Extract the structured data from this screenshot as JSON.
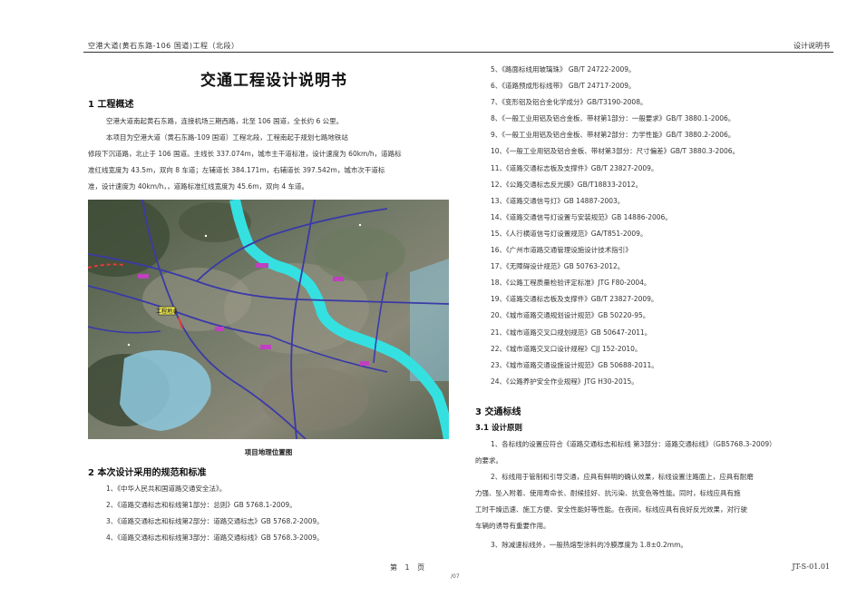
{
  "header": {
    "left": "空港大道(黄石东路-106 国道)工程（北段）",
    "right": "设计说明书"
  },
  "title": "交通工程设计说明书",
  "section1": {
    "heading": "1  工程概述",
    "paragraphs": [
      "空港大道南起黄石东路，连接机场三期西路，北至 106 国道，全长约 6 公里。",
      "本项目为空港大道（黄石东路-109 国道）工程北段，工程南起于规划七路地铁站",
      "修段下沉道路，北止于 106 国道。主线长 337.074m，城市主干道标准，设计速度为 60km/h，道路标",
      "准红线宽度为 43.5m，双向 8 车道；左辅道长 384.171m，右辅道长 397.542m，城市次干道标",
      "准，设计速度为 40km/h，，道路标准红线宽度为 45.6m，双向 4 车道。"
    ]
  },
  "map": {
    "caption": "项目地理位置图",
    "label": "工程地点"
  },
  "section2": {
    "heading": "2  本次设计采用的规范和标准",
    "items": [
      "1、《中华人民共和国道路交通安全法》。",
      "2、《道路交通标志和标线第1部分：总则》GB  5768.1-2009。",
      "3、《道路交通标志和标线第2部分：道路交通标志》GB  5768.2-2009。",
      "4、《道路交通标志和标线第3部分：道路交通标线》GB  5768.3-2009。"
    ]
  },
  "right_list": {
    "items": [
      "5、《路面标线用玻璃珠》  GB/T  24722-2009。",
      "6、《道路预成形标线带》  GB/T  24717-2009。",
      "7、《变形铝及铝合金化学成分》GB/T3190-2008。",
      "8、《一般工业用铝及铝合金板、带材第1部分：一般要求》GB/T  3880.1-2006。",
      "9、《一般工业用铝及铝合金板、带材第2部分：力学性能》GB/T  3880.2-2006。",
      "10、《一般工业用铝及铝合金板、带材第3部分：尺寸偏差》GB/T  3880.3-2006。",
      "11、《道路交通标志板及支撑件》GB/T  23827-2009。",
      "12、《公路交通标志反光膜》GB/T18833-2012。",
      "13、《道路交通信号灯》GB  14887-2003。",
      "14、《道路交通信号灯设置与安装规范》GB  14886-2006。",
      "15、《人行横道信号灯设置规范》GA/T851-2009。",
      "16、《广州市道路交通管理设施设计技术指引》",
      "17、《无障碍设计规范》GB  50763-2012。",
      "18、《公路工程质量检验评定标准》JTG  F80-2004。",
      "19、《道路交通标志板及支撑件》GB/T  23827-2009。",
      "20、《城市道路交通规划设计规范》GB  50220-95。",
      "21、《城市道路交叉口规划规范》GB  50647-2011。",
      "22、《城市道路交叉口设计规程》CJJ  152-2010。",
      "23、《城市道路交通设施设计规范》GB  50688-2011。",
      "24、《公路养护安全作业规程》JTG  H30-2015。"
    ]
  },
  "section3": {
    "heading": "3  交通标线",
    "sub_heading": "3.1  设计原则",
    "paragraphs": [
      "1、各标线的设置应符合《道路交通标志和标线  第3部分：道路交通标线》（GB5768.3-2009）",
      "的要求。",
      "2、标线用于管制和引导交通，应具有鲜明的确认效果，标线设置注路面上，应具有耐磨",
      "力强、坠入附着、使用寿命长、耐候挂好、抗污染、抗变色等性能。同时，标线应具有施",
      "工时干燥迅速、施工方便、安全性能好等性能。在夜间，标线应具有良好反光效果，对行驶",
      "车辆的诱导有重要作用。",
      "3、除减速标线外，一般热熔型涂料的冷膜厚度为 1.8±0.2mm。"
    ]
  },
  "footer": {
    "page": "第  1  页",
    "code": "JT-S-01.01",
    "small": "/07"
  },
  "colors": {
    "river": "#35e0e0",
    "road": "#3a3aa8",
    "reservoir": "#8cc6dc",
    "label_bg": "#e6e050"
  }
}
